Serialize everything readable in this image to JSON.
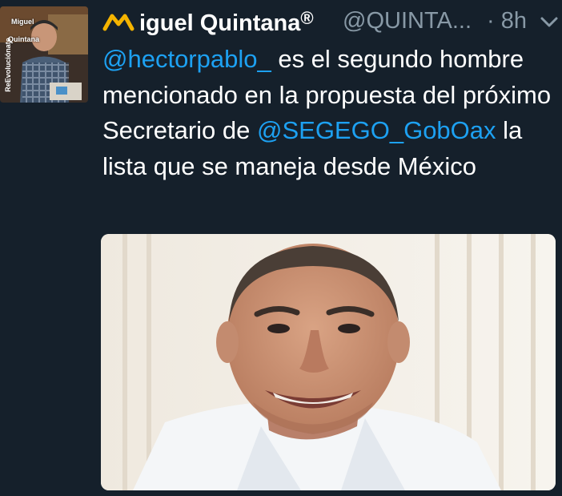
{
  "tweet": {
    "avatar": {
      "overlay_line1": "Miguel",
      "overlay_line2": "Quintana",
      "overlay_side": "ReEvoluciónate"
    },
    "author": {
      "display_name": "iguel Quintana",
      "registered_mark": "®",
      "handle": "@QUINTA...",
      "brand_icon": "m-logo-icon"
    },
    "timestamp": "· 8h",
    "menu_icon": "chevron-down-icon",
    "text": {
      "mention1": "@hectorpablo_",
      "part1": " es el segundo hombre mencionado en la propuesta del próximo Secretario de ",
      "mention2": "@SEGEGO_GobOax",
      "part2": " la lista que se maneja desde México"
    },
    "media": {
      "type": "photo",
      "subject": "portrait-photo"
    }
  },
  "colors": {
    "background": "#15202b",
    "link": "#1da1f2",
    "muted": "#8899a6",
    "brand": "#f5b400"
  }
}
